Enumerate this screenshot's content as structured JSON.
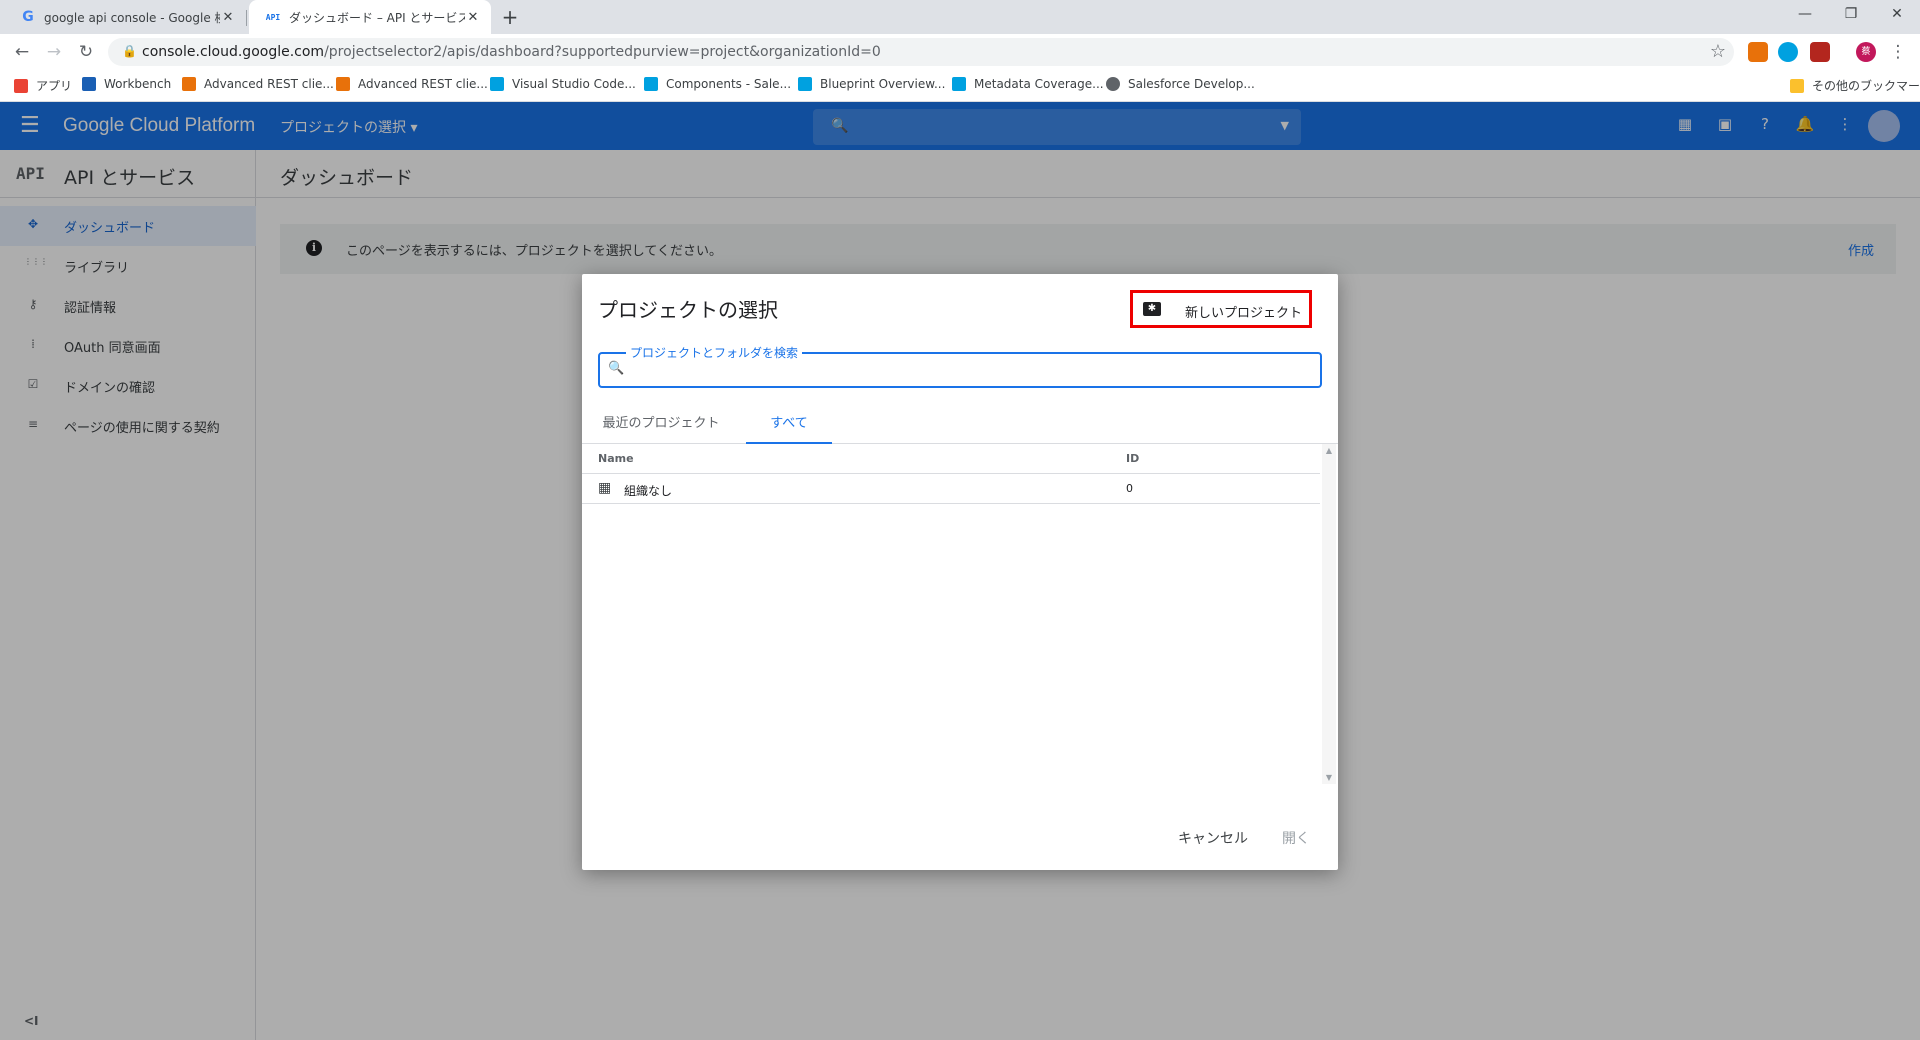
{
  "browser": {
    "tabs": [
      {
        "title": "google api console - Google 検索",
        "favicon": "google-g"
      },
      {
        "title": "ダッシュボード – API とサービス – Google Cloud Platform",
        "favicon": "API"
      }
    ],
    "address": {
      "host": "console.cloud.google.com",
      "path": "/projectselector2/apis/dashboard?supportedpurview=project&organizationId=0"
    },
    "profile_initial": "蔡",
    "bookmarks": [
      {
        "label": "アプリ",
        "color": "#ea4335"
      },
      {
        "label": "Workbench",
        "color": "#1a5fb4"
      },
      {
        "label": "Advanced REST clie...",
        "color": "#e8710a"
      },
      {
        "label": "Advanced REST clie...",
        "color": "#e8710a"
      },
      {
        "label": "Visual Studio Code...",
        "color": "#00a1e0"
      },
      {
        "label": "Components - Sale...",
        "color": "#00a1e0"
      },
      {
        "label": "Blueprint Overview...",
        "color": "#00a1e0"
      },
      {
        "label": "Metadata Coverage...",
        "color": "#00a1e0"
      },
      {
        "label": "Salesforce Develop...",
        "color": "#5f6368"
      }
    ],
    "other_bookmarks": "その他のブックマーク"
  },
  "header": {
    "brand": "Google Cloud Platform",
    "project_selector": "プロジェクトの選択",
    "accent": "#1a73e8"
  },
  "sidebar": {
    "logo": "API",
    "title": "API とサービス",
    "items": [
      {
        "label": "ダッシュボード",
        "icon": "dashboard-icon",
        "glyph": "✥"
      },
      {
        "label": "ライブラリ",
        "icon": "library-icon",
        "glyph": "⋮⋮⋮"
      },
      {
        "label": "認証情報",
        "icon": "key-icon",
        "glyph": "⚷"
      },
      {
        "label": "OAuth 同意画面",
        "icon": "consent-icon",
        "glyph": "⁞"
      },
      {
        "label": "ドメインの確認",
        "icon": "domain-check-icon",
        "glyph": "☑"
      },
      {
        "label": "ページの使用に関する契約",
        "icon": "settings-list-icon",
        "glyph": "≡"
      }
    ],
    "collapse": "<I"
  },
  "main": {
    "title": "ダッシュボード",
    "banner": {
      "text": "このページを表示するには、プロジェクトを選択してください。",
      "link": "作成"
    }
  },
  "dialog": {
    "title": "プロジェクトの選択",
    "new_project": "新しいプロジェクト",
    "search_label": "プロジェクトとフォルダを検索",
    "tabs": [
      "最近のプロジェクト",
      "すべて"
    ],
    "columns": [
      "Name",
      "ID"
    ],
    "rows": [
      {
        "name": "組織なし",
        "id": "0"
      }
    ],
    "cancel": "キャンセル",
    "open": "開く"
  }
}
